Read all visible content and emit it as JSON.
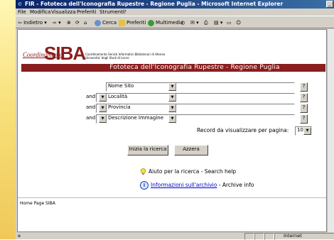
{
  "window": {
    "title": "FIR - Fototeca dell'Iconografia Rupestre - Regione Puglia - Microsoft Internet Explorer"
  },
  "menu": [
    "File",
    "Modifica",
    "Visualizza",
    "Preferiti",
    "Strumenti",
    "?"
  ],
  "toolbar": {
    "back": "Indietro",
    "search": "Cerca",
    "favorites": "Preferiti",
    "media": "Multimedia"
  },
  "logo": {
    "left": "Coordinamento",
    "main": "SIBA",
    "sub1": "Coordinamento Servizi Informatici Bibliotecari di Ateneo",
    "sub2": "Universita' degli Studi di Lecce"
  },
  "banner": "Fototeca dell'Iconografia Rupestre - Regione Puglia",
  "form": {
    "rows": [
      {
        "op": "",
        "field": "Nome Sito"
      },
      {
        "op": "and",
        "field": "Località"
      },
      {
        "op": "and",
        "field": "Provincia"
      },
      {
        "op": "and",
        "field": "Descrizione Immagine"
      }
    ],
    "help": "?",
    "records_label": "Record da visualizzare per pagina:",
    "records_value": "10",
    "submit": "Inizia la ricerca",
    "reset": "Azzera"
  },
  "help_links": {
    "search_help": "Aiuto per la ricerca - Search help",
    "archive_link": "Informazioni sull'archivio",
    "archive_suffix": " - Archive info"
  },
  "footer": "Home Page SIBA",
  "status": {
    "zone": "Internet"
  },
  "colors": {
    "brand": "#8a1d1d",
    "title_bar": "#0a246a",
    "link": "#0000cc"
  }
}
